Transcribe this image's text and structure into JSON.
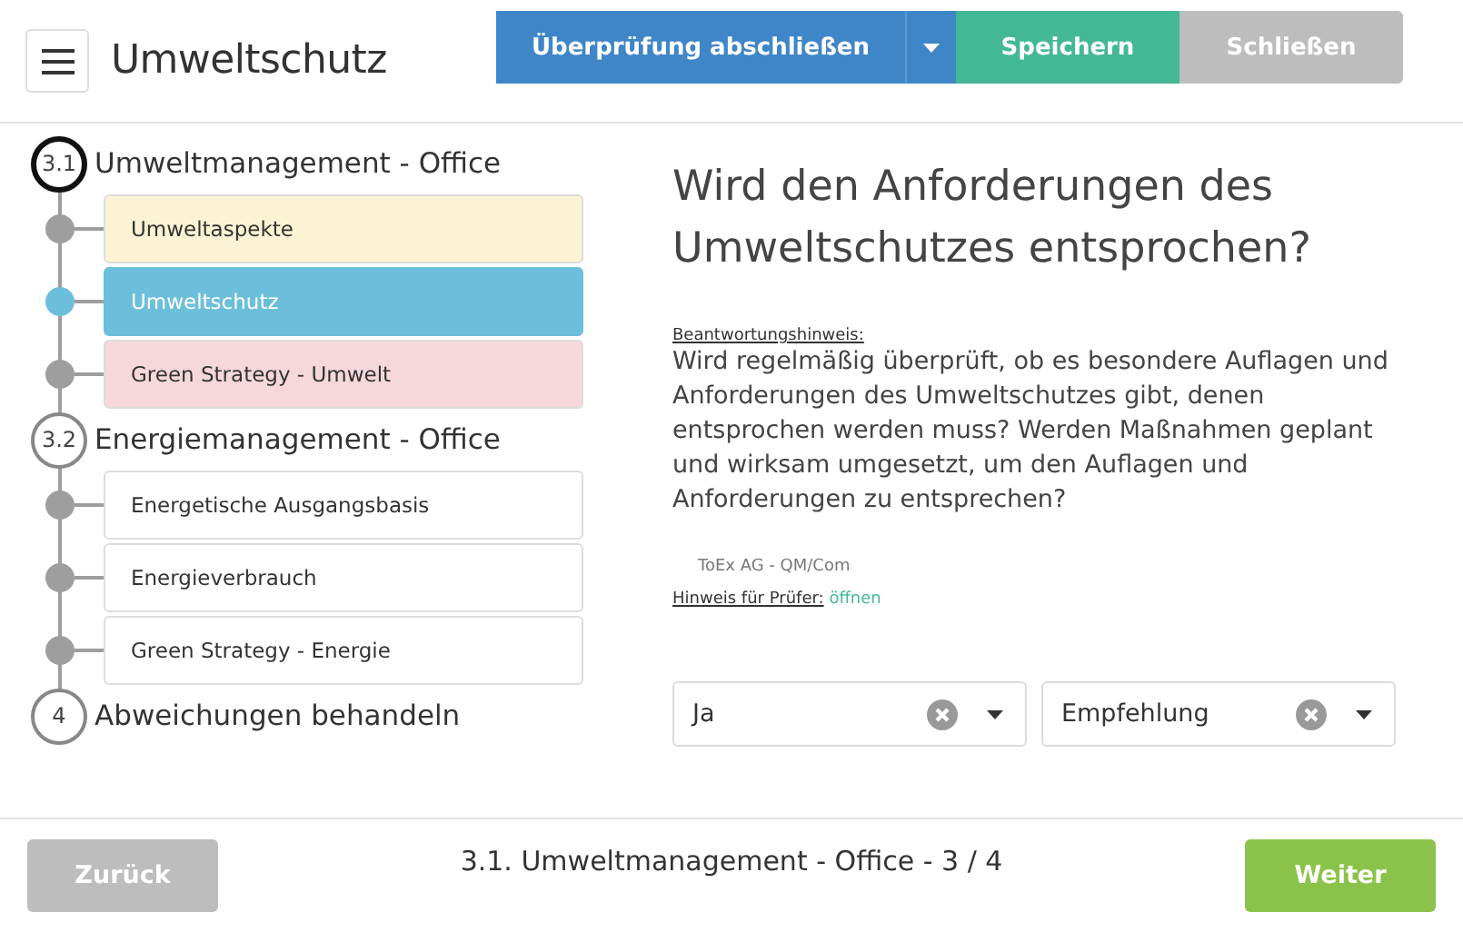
{
  "header": {
    "title": "Umweltschutz",
    "buttons": [
      {
        "label": "Überprüfung abschließen",
        "kind": "primary"
      },
      {
        "label": "Speichern",
        "kind": "save"
      },
      {
        "label": "Schließen",
        "kind": "disabled"
      }
    ]
  },
  "sections": [
    {
      "number": "3.1",
      "title": "Umweltmanagement - Office",
      "current": true,
      "children": [
        {
          "label": "Umweltaspekte",
          "selected": false,
          "color": "#fcf3d4"
        },
        {
          "label": "Umweltschutz",
          "selected": true,
          "color": "#6cbfdb"
        },
        {
          "label": "Green Strategy - Umwelt",
          "selected": false,
          "color": "#f5d7dc"
        }
      ]
    },
    {
      "number": "3.2",
      "title": "Energiemanagement - Office",
      "current": false,
      "children": [
        {
          "label": "Energetische Ausgangsbasis",
          "selected": false,
          "color": "#ffffff"
        },
        {
          "label": "Energieverbrauch",
          "selected": false,
          "color": "#ffffff"
        },
        {
          "label": "Green Strategy - Energie",
          "selected": false,
          "color": "#ffffff"
        }
      ]
    },
    {
      "number": "4",
      "title": "Abweichungen behandeln",
      "current": false
    }
  ],
  "question": {
    "title": "Wird den Anforderungen des Umweltschutzes entsprochen?",
    "hint_label": "Beantwortungshinweis:",
    "hint": "Wird regelmäßig überprüft, ob es besondere Auflagen und Anforderungen des Umweltschutzes gibt, denen entsprochen werden muss? Werden Maßnahmen geplant und wirksam umgesetzt, um den Auflagen und Anforderungen zu entsprechen?",
    "source": "ToEx AG - QM/Com",
    "reviewer_label": "Hinweis für Prüfer:",
    "reviewer_link": "öffnen"
  },
  "selects": [
    {
      "value": "Ja"
    },
    {
      "value": "Empfehlung"
    }
  ],
  "footer": {
    "back": "Zurück",
    "progress": "3.1. Umweltmanagement - Office - 3 / 4",
    "next": "Weiter"
  }
}
